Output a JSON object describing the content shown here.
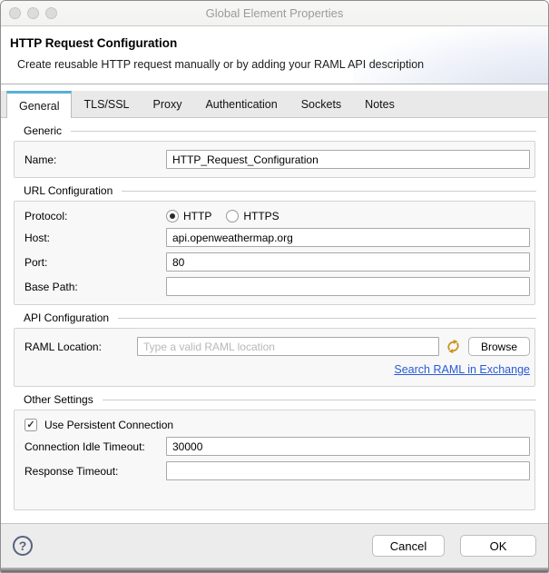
{
  "window_title": "Global Element Properties",
  "header": {
    "title": "HTTP Request Configuration",
    "subtitle": "Create reusable HTTP request manually or by adding your RAML API description"
  },
  "tabs": [
    {
      "label": "General",
      "active": true
    },
    {
      "label": "TLS/SSL",
      "active": false
    },
    {
      "label": "Proxy",
      "active": false
    },
    {
      "label": "Authentication",
      "active": false
    },
    {
      "label": "Sockets",
      "active": false
    },
    {
      "label": "Notes",
      "active": false
    }
  ],
  "generic": {
    "section_title": "Generic",
    "name_label": "Name:",
    "name_value": "HTTP_Request_Configuration"
  },
  "url_configuration": {
    "section_title": "URL Configuration",
    "protocol_label": "Protocol:",
    "protocol_options": [
      {
        "label": "HTTP",
        "selected": true
      },
      {
        "label": "HTTPS",
        "selected": false
      }
    ],
    "host_label": "Host:",
    "host_value": "api.openweathermap.org",
    "port_label": "Port:",
    "port_value": "80",
    "base_path_label": "Base Path:",
    "base_path_value": ""
  },
  "api_configuration": {
    "section_title": "API Configuration",
    "raml_label": "RAML Location:",
    "raml_value": "",
    "raml_placeholder": "Type a valid RAML location",
    "sync_icon": "sync-arrows",
    "browse_label": "Browse",
    "exchange_link_label": "Search RAML in Exchange"
  },
  "other_settings": {
    "section_title": "Other Settings",
    "persistent_label": "Use Persistent Connection",
    "persistent_checked": true,
    "idle_label": "Connection Idle Timeout:",
    "idle_value": "30000",
    "response_label": "Response Timeout:",
    "response_value": ""
  },
  "footer": {
    "help_glyph": "?",
    "cancel_label": "Cancel",
    "ok_label": "OK"
  },
  "colors": {
    "tab_accent": "#58b0d4",
    "link": "#2a5bd7",
    "sync_icon": "#c9941f",
    "help_icon": "#56637e"
  }
}
